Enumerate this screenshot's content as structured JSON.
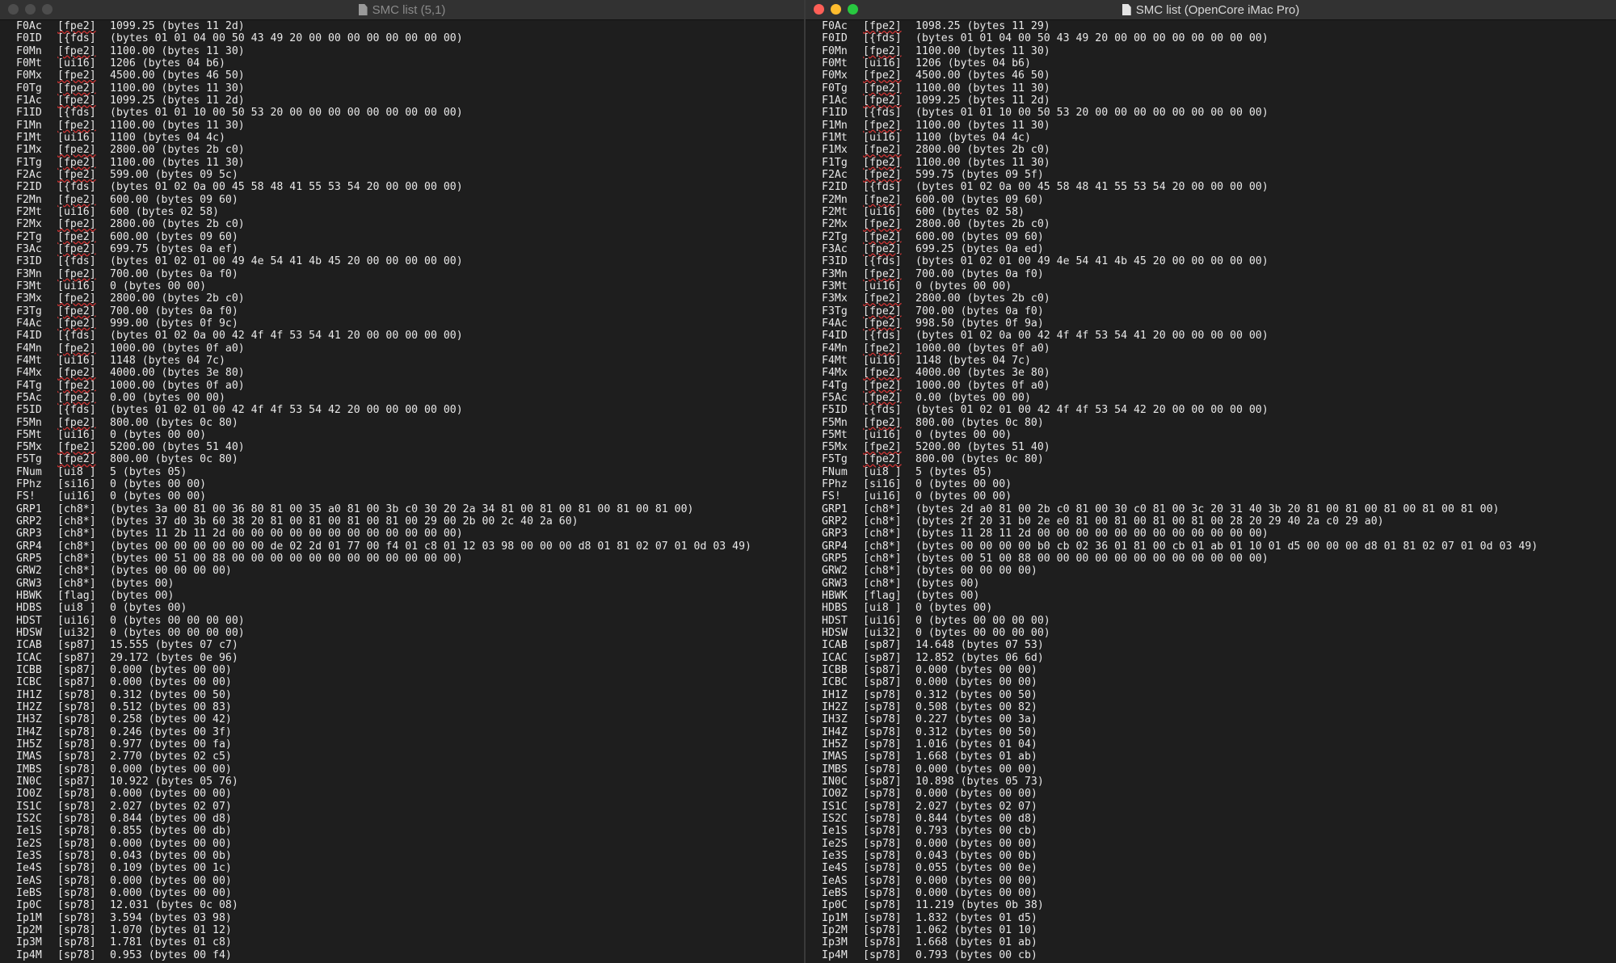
{
  "windows": [
    {
      "id": "left",
      "title": "SMC list (5,1)",
      "active": false,
      "rows": [
        {
          "key": "F0Ac",
          "type": "[fpe2]",
          "value": "1099.25 (bytes 11 2d)"
        },
        {
          "key": "F0ID",
          "type": "[{fds]",
          "value": "(bytes 01 01 04 00 50 43 49 20 00 00 00 00 00 00 00 00)"
        },
        {
          "key": "F0Mn",
          "type": "[fpe2]",
          "value": "1100.00 (bytes 11 30)"
        },
        {
          "key": "F0Mt",
          "type": "[ui16]",
          "value": "1206 (bytes 04 b6)"
        },
        {
          "key": "F0Mx",
          "type": "[fpe2]",
          "value": "4500.00 (bytes 46 50)"
        },
        {
          "key": "F0Tg",
          "type": "[fpe2]",
          "value": "1100.00 (bytes 11 30)"
        },
        {
          "key": "F1Ac",
          "type": "[fpe2]",
          "value": "1099.25 (bytes 11 2d)"
        },
        {
          "key": "F1ID",
          "type": "[{fds]",
          "value": "(bytes 01 01 10 00 50 53 20 00 00 00 00 00 00 00 00 00)"
        },
        {
          "key": "F1Mn",
          "type": "[fpe2]",
          "value": "1100.00 (bytes 11 30)"
        },
        {
          "key": "F1Mt",
          "type": "[ui16]",
          "value": "1100 (bytes 04 4c)"
        },
        {
          "key": "F1Mx",
          "type": "[fpe2]",
          "value": "2800.00 (bytes 2b c0)"
        },
        {
          "key": "F1Tg",
          "type": "[fpe2]",
          "value": "1100.00 (bytes 11 30)"
        },
        {
          "key": "F2Ac",
          "type": "[fpe2]",
          "value": "599.00 (bytes 09 5c)"
        },
        {
          "key": "F2ID",
          "type": "[{fds]",
          "value": "(bytes 01 02 0a 00 45 58 48 41 55 53 54 20 00 00 00 00)"
        },
        {
          "key": "F2Mn",
          "type": "[fpe2]",
          "value": "600.00 (bytes 09 60)"
        },
        {
          "key": "F2Mt",
          "type": "[ui16]",
          "value": "600 (bytes 02 58)"
        },
        {
          "key": "F2Mx",
          "type": "[fpe2]",
          "value": "2800.00 (bytes 2b c0)"
        },
        {
          "key": "F2Tg",
          "type": "[fpe2]",
          "value": "600.00 (bytes 09 60)"
        },
        {
          "key": "F3Ac",
          "type": "[fpe2]",
          "value": "699.75 (bytes 0a ef)"
        },
        {
          "key": "F3ID",
          "type": "[{fds]",
          "value": "(bytes 01 02 01 00 49 4e 54 41 4b 45 20 00 00 00 00 00)"
        },
        {
          "key": "F3Mn",
          "type": "[fpe2]",
          "value": "700.00 (bytes 0a f0)"
        },
        {
          "key": "F3Mt",
          "type": "[ui16]",
          "value": "0 (bytes 00 00)"
        },
        {
          "key": "F3Mx",
          "type": "[fpe2]",
          "value": "2800.00 (bytes 2b c0)"
        },
        {
          "key": "F3Tg",
          "type": "[fpe2]",
          "value": "700.00 (bytes 0a f0)"
        },
        {
          "key": "F4Ac",
          "type": "[fpe2]",
          "value": "999.00 (bytes 0f 9c)"
        },
        {
          "key": "F4ID",
          "type": "[{fds]",
          "value": "(bytes 01 02 0a 00 42 4f 4f 53 54 41 20 00 00 00 00 00)"
        },
        {
          "key": "F4Mn",
          "type": "[fpe2]",
          "value": "1000.00 (bytes 0f a0)"
        },
        {
          "key": "F4Mt",
          "type": "[ui16]",
          "value": "1148 (bytes 04 7c)"
        },
        {
          "key": "F4Mx",
          "type": "[fpe2]",
          "value": "4000.00 (bytes 3e 80)"
        },
        {
          "key": "F4Tg",
          "type": "[fpe2]",
          "value": "1000.00 (bytes 0f a0)"
        },
        {
          "key": "F5Ac",
          "type": "[fpe2]",
          "value": "0.00 (bytes 00 00)"
        },
        {
          "key": "F5ID",
          "type": "[{fds]",
          "value": "(bytes 01 02 01 00 42 4f 4f 53 54 42 20 00 00 00 00 00)"
        },
        {
          "key": "F5Mn",
          "type": "[fpe2]",
          "value": "800.00 (bytes 0c 80)"
        },
        {
          "key": "F5Mt",
          "type": "[ui16]",
          "value": "0 (bytes 00 00)"
        },
        {
          "key": "F5Mx",
          "type": "[fpe2]",
          "value": "5200.00 (bytes 51 40)"
        },
        {
          "key": "F5Tg",
          "type": "[fpe2]",
          "value": "800.00 (bytes 0c 80)"
        },
        {
          "key": "FNum",
          "type": "[ui8 ]",
          "value": "5 (bytes 05)"
        },
        {
          "key": "FPhz",
          "type": "[si16]",
          "value": "0 (bytes 00 00)"
        },
        {
          "key": "FS!",
          "type": "[ui16]",
          "value": "0 (bytes 00 00)"
        },
        {
          "key": "GRP1",
          "type": "[ch8*]",
          "value": "(bytes 3a 00 81 00 36 80 81 00 35 a0 81 00 3b c0 30 20 2a 34 81 00 81 00 81 00 81 00 81 00)"
        },
        {
          "key": "GRP2",
          "type": "[ch8*]",
          "value": "(bytes 37 d0 3b 60 38 20 81 00 81 00 81 00 81 00 29 00 2b 00 2c 40 2a 60)"
        },
        {
          "key": "GRP3",
          "type": "[ch8*]",
          "value": "(bytes 11 2b 11 2d 00 00 00 00 00 00 00 00 00 00 00 00)"
        },
        {
          "key": "GRP4",
          "type": "[ch8*]",
          "value": "(bytes 00 00 00 00 00 00 de 02 2d 01 77 00 f4 01 c8 01 12 03 98 00 00 00 d8 01 81 02 07 01 0d 03 49)"
        },
        {
          "key": "GRP5",
          "type": "[ch8*]",
          "value": "(bytes 00 51 00 88 00 00 00 00 00 00 00 00 00 00 00 00)"
        },
        {
          "key": "GRW2",
          "type": "[ch8*]",
          "value": "(bytes 00 00 00 00)"
        },
        {
          "key": "GRW3",
          "type": "[ch8*]",
          "value": "(bytes 00)"
        },
        {
          "key": "HBWK",
          "type": "[flag]",
          "value": "(bytes 00)"
        },
        {
          "key": "HDBS",
          "type": "[ui8 ]",
          "value": "0 (bytes 00)"
        },
        {
          "key": "HDST",
          "type": "[ui16]",
          "value": "0 (bytes 00 00 00 00)"
        },
        {
          "key": "HDSW",
          "type": "[ui32]",
          "value": "0 (bytes 00 00 00 00)"
        },
        {
          "key": "ICAB",
          "type": "[sp87]",
          "value": "15.555 (bytes 07 c7)"
        },
        {
          "key": "ICAC",
          "type": "[sp87]",
          "value": "29.172 (bytes 0e 96)"
        },
        {
          "key": "ICBB",
          "type": "[sp87]",
          "value": "0.000 (bytes 00 00)"
        },
        {
          "key": "ICBC",
          "type": "[sp87]",
          "value": "0.000 (bytes 00 00)"
        },
        {
          "key": "IH1Z",
          "type": "[sp78]",
          "value": "0.312 (bytes 00 50)"
        },
        {
          "key": "IH2Z",
          "type": "[sp78]",
          "value": "0.512 (bytes 00 83)"
        },
        {
          "key": "IH3Z",
          "type": "[sp78]",
          "value": "0.258 (bytes 00 42)"
        },
        {
          "key": "IH4Z",
          "type": "[sp78]",
          "value": "0.246 (bytes 00 3f)"
        },
        {
          "key": "IH5Z",
          "type": "[sp78]",
          "value": "0.977 (bytes 00 fa)"
        },
        {
          "key": "IMAS",
          "type": "[sp78]",
          "value": "2.770 (bytes 02 c5)"
        },
        {
          "key": "IMBS",
          "type": "[sp78]",
          "value": "0.000 (bytes 00 00)"
        },
        {
          "key": "IN0C",
          "type": "[sp87]",
          "value": "10.922 (bytes 05 76)"
        },
        {
          "key": "IO0Z",
          "type": "[sp78]",
          "value": "0.000 (bytes 00 00)"
        },
        {
          "key": "IS1C",
          "type": "[sp78]",
          "value": "2.027 (bytes 02 07)"
        },
        {
          "key": "IS2C",
          "type": "[sp78]",
          "value": "0.844 (bytes 00 d8)"
        },
        {
          "key": "Ie1S",
          "type": "[sp78]",
          "value": "0.855 (bytes 00 db)"
        },
        {
          "key": "Ie2S",
          "type": "[sp78]",
          "value": "0.000 (bytes 00 00)"
        },
        {
          "key": "Ie3S",
          "type": "[sp78]",
          "value": "0.043 (bytes 00 0b)"
        },
        {
          "key": "Ie4S",
          "type": "[sp78]",
          "value": "0.109 (bytes 00 1c)"
        },
        {
          "key": "IeAS",
          "type": "[sp78]",
          "value": "0.000 (bytes 00 00)"
        },
        {
          "key": "IeBS",
          "type": "[sp78]",
          "value": "0.000 (bytes 00 00)"
        },
        {
          "key": "Ip0C",
          "type": "[sp78]",
          "value": "12.031 (bytes 0c 08)"
        },
        {
          "key": "Ip1M",
          "type": "[sp78]",
          "value": "3.594 (bytes 03 98)"
        },
        {
          "key": "Ip2M",
          "type": "[sp78]",
          "value": "1.070 (bytes 01 12)"
        },
        {
          "key": "Ip3M",
          "type": "[sp78]",
          "value": "1.781 (bytes 01 c8)"
        },
        {
          "key": "Ip4M",
          "type": "[sp78]",
          "value": "0.953 (bytes 00 f4)"
        }
      ]
    },
    {
      "id": "right",
      "title": "SMC list (OpenCore iMac Pro)",
      "active": true,
      "rows": [
        {
          "key": "F0Ac",
          "type": "[fpe2]",
          "value": "1098.25 (bytes 11 29)"
        },
        {
          "key": "F0ID",
          "type": "[{fds]",
          "value": "(bytes 01 01 04 00 50 43 49 20 00 00 00 00 00 00 00 00)"
        },
        {
          "key": "F0Mn",
          "type": "[fpe2]",
          "value": "1100.00 (bytes 11 30)"
        },
        {
          "key": "F0Mt",
          "type": "[ui16]",
          "value": "1206 (bytes 04 b6)"
        },
        {
          "key": "F0Mx",
          "type": "[fpe2]",
          "value": "4500.00 (bytes 46 50)"
        },
        {
          "key": "F0Tg",
          "type": "[fpe2]",
          "value": "1100.00 (bytes 11 30)"
        },
        {
          "key": "F1Ac",
          "type": "[fpe2]",
          "value": "1099.25 (bytes 11 2d)"
        },
        {
          "key": "F1ID",
          "type": "[{fds]",
          "value": "(bytes 01 01 10 00 50 53 20 00 00 00 00 00 00 00 00 00)"
        },
        {
          "key": "F1Mn",
          "type": "[fpe2]",
          "value": "1100.00 (bytes 11 30)"
        },
        {
          "key": "F1Mt",
          "type": "[ui16]",
          "value": "1100 (bytes 04 4c)"
        },
        {
          "key": "F1Mx",
          "type": "[fpe2]",
          "value": "2800.00 (bytes 2b c0)"
        },
        {
          "key": "F1Tg",
          "type": "[fpe2]",
          "value": "1100.00 (bytes 11 30)"
        },
        {
          "key": "F2Ac",
          "type": "[fpe2]",
          "value": "599.75 (bytes 09 5f)"
        },
        {
          "key": "F2ID",
          "type": "[{fds]",
          "value": "(bytes 01 02 0a 00 45 58 48 41 55 53 54 20 00 00 00 00)"
        },
        {
          "key": "F2Mn",
          "type": "[fpe2]",
          "value": "600.00 (bytes 09 60)"
        },
        {
          "key": "F2Mt",
          "type": "[ui16]",
          "value": "600 (bytes 02 58)"
        },
        {
          "key": "F2Mx",
          "type": "[fpe2]",
          "value": "2800.00 (bytes 2b c0)"
        },
        {
          "key": "F2Tg",
          "type": "[fpe2]",
          "value": "600.00 (bytes 09 60)"
        },
        {
          "key": "F3Ac",
          "type": "[fpe2]",
          "value": "699.25 (bytes 0a ed)"
        },
        {
          "key": "F3ID",
          "type": "[{fds]",
          "value": "(bytes 01 02 01 00 49 4e 54 41 4b 45 20 00 00 00 00 00)"
        },
        {
          "key": "F3Mn",
          "type": "[fpe2]",
          "value": "700.00 (bytes 0a f0)"
        },
        {
          "key": "F3Mt",
          "type": "[ui16]",
          "value": "0 (bytes 00 00)"
        },
        {
          "key": "F3Mx",
          "type": "[fpe2]",
          "value": "2800.00 (bytes 2b c0)"
        },
        {
          "key": "F3Tg",
          "type": "[fpe2]",
          "value": "700.00 (bytes 0a f0)"
        },
        {
          "key": "F4Ac",
          "type": "[fpe2]",
          "value": "998.50 (bytes 0f 9a)"
        },
        {
          "key": "F4ID",
          "type": "[{fds]",
          "value": "(bytes 01 02 0a 00 42 4f 4f 53 54 41 20 00 00 00 00 00)"
        },
        {
          "key": "F4Mn",
          "type": "[fpe2]",
          "value": "1000.00 (bytes 0f a0)"
        },
        {
          "key": "F4Mt",
          "type": "[ui16]",
          "value": "1148 (bytes 04 7c)"
        },
        {
          "key": "F4Mx",
          "type": "[fpe2]",
          "value": "4000.00 (bytes 3e 80)"
        },
        {
          "key": "F4Tg",
          "type": "[fpe2]",
          "value": "1000.00 (bytes 0f a0)"
        },
        {
          "key": "F5Ac",
          "type": "[fpe2]",
          "value": "0.00 (bytes 00 00)"
        },
        {
          "key": "F5ID",
          "type": "[{fds]",
          "value": "(bytes 01 02 01 00 42 4f 4f 53 54 42 20 00 00 00 00 00)"
        },
        {
          "key": "F5Mn",
          "type": "[fpe2]",
          "value": "800.00 (bytes 0c 80)"
        },
        {
          "key": "F5Mt",
          "type": "[ui16]",
          "value": "0 (bytes 00 00)"
        },
        {
          "key": "F5Mx",
          "type": "[fpe2]",
          "value": "5200.00 (bytes 51 40)"
        },
        {
          "key": "F5Tg",
          "type": "[fpe2]",
          "value": "800.00 (bytes 0c 80)"
        },
        {
          "key": "FNum",
          "type": "[ui8 ]",
          "value": "5 (bytes 05)"
        },
        {
          "key": "FPhz",
          "type": "[si16]",
          "value": "0 (bytes 00 00)"
        },
        {
          "key": "FS!",
          "type": "[ui16]",
          "value": "0 (bytes 00 00)"
        },
        {
          "key": "GRP1",
          "type": "[ch8*]",
          "value": "(bytes 2d a0 81 00 2b c0 81 00 30 c0 81 00 3c 20 31 40 3b 20 81 00 81 00 81 00 81 00 81 00)"
        },
        {
          "key": "GRP2",
          "type": "[ch8*]",
          "value": "(bytes 2f 20 31 b0 2e e0 81 00 81 00 81 00 81 00 28 20 29 40 2a c0 29 a0)"
        },
        {
          "key": "GRP3",
          "type": "[ch8*]",
          "value": "(bytes 11 28 11 2d 00 00 00 00 00 00 00 00 00 00 00 00)"
        },
        {
          "key": "GRP4",
          "type": "[ch8*]",
          "value": "(bytes 00 00 00 00 b0 cb 02 36 01 81 00 cb 01 ab 01 10 01 d5 00 00 00 d8 01 81 02 07 01 0d 03 49)"
        },
        {
          "key": "GRP5",
          "type": "[ch8*]",
          "value": "(bytes 00 51 00 88 00 00 00 00 00 00 00 00 00 00 00 00)"
        },
        {
          "key": "GRW2",
          "type": "[ch8*]",
          "value": "(bytes 00 00 00 00)"
        },
        {
          "key": "GRW3",
          "type": "[ch8*]",
          "value": "(bytes 00)"
        },
        {
          "key": "HBWK",
          "type": "[flag]",
          "value": "(bytes 00)"
        },
        {
          "key": "HDBS",
          "type": "[ui8 ]",
          "value": "0 (bytes 00)"
        },
        {
          "key": "HDST",
          "type": "[ui16]",
          "value": "0 (bytes 00 00 00 00)"
        },
        {
          "key": "HDSW",
          "type": "[ui32]",
          "value": "0 (bytes 00 00 00 00)"
        },
        {
          "key": "ICAB",
          "type": "[sp87]",
          "value": "14.648 (bytes 07 53)"
        },
        {
          "key": "ICAC",
          "type": "[sp87]",
          "value": "12.852 (bytes 06 6d)"
        },
        {
          "key": "ICBB",
          "type": "[sp87]",
          "value": "0.000 (bytes 00 00)"
        },
        {
          "key": "ICBC",
          "type": "[sp87]",
          "value": "0.000 (bytes 00 00)"
        },
        {
          "key": "IH1Z",
          "type": "[sp78]",
          "value": "0.312 (bytes 00 50)"
        },
        {
          "key": "IH2Z",
          "type": "[sp78]",
          "value": "0.508 (bytes 00 82)"
        },
        {
          "key": "IH3Z",
          "type": "[sp78]",
          "value": "0.227 (bytes 00 3a)"
        },
        {
          "key": "IH4Z",
          "type": "[sp78]",
          "value": "0.312 (bytes 00 50)"
        },
        {
          "key": "IH5Z",
          "type": "[sp78]",
          "value": "1.016 (bytes 01 04)"
        },
        {
          "key": "IMAS",
          "type": "[sp78]",
          "value": "1.668 (bytes 01 ab)"
        },
        {
          "key": "IMBS",
          "type": "[sp78]",
          "value": "0.000 (bytes 00 00)"
        },
        {
          "key": "IN0C",
          "type": "[sp87]",
          "value": "10.898 (bytes 05 73)"
        },
        {
          "key": "IO0Z",
          "type": "[sp78]",
          "value": "0.000 (bytes 00 00)"
        },
        {
          "key": "IS1C",
          "type": "[sp78]",
          "value": "2.027 (bytes 02 07)"
        },
        {
          "key": "IS2C",
          "type": "[sp78]",
          "value": "0.844 (bytes 00 d8)"
        },
        {
          "key": "Ie1S",
          "type": "[sp78]",
          "value": "0.793 (bytes 00 cb)"
        },
        {
          "key": "Ie2S",
          "type": "[sp78]",
          "value": "0.000 (bytes 00 00)"
        },
        {
          "key": "Ie3S",
          "type": "[sp78]",
          "value": "0.043 (bytes 00 0b)"
        },
        {
          "key": "Ie4S",
          "type": "[sp78]",
          "value": "0.055 (bytes 00 0e)"
        },
        {
          "key": "IeAS",
          "type": "[sp78]",
          "value": "0.000 (bytes 00 00)"
        },
        {
          "key": "IeBS",
          "type": "[sp78]",
          "value": "0.000 (bytes 00 00)"
        },
        {
          "key": "Ip0C",
          "type": "[sp78]",
          "value": "11.219 (bytes 0b 38)"
        },
        {
          "key": "Ip1M",
          "type": "[sp78]",
          "value": "1.832 (bytes 01 d5)"
        },
        {
          "key": "Ip2M",
          "type": "[sp78]",
          "value": "1.062 (bytes 01 10)"
        },
        {
          "key": "Ip3M",
          "type": "[sp78]",
          "value": "1.668 (bytes 01 ab)"
        },
        {
          "key": "Ip4M",
          "type": "[sp78]",
          "value": "0.793 (bytes 00 cb)"
        }
      ]
    }
  ]
}
